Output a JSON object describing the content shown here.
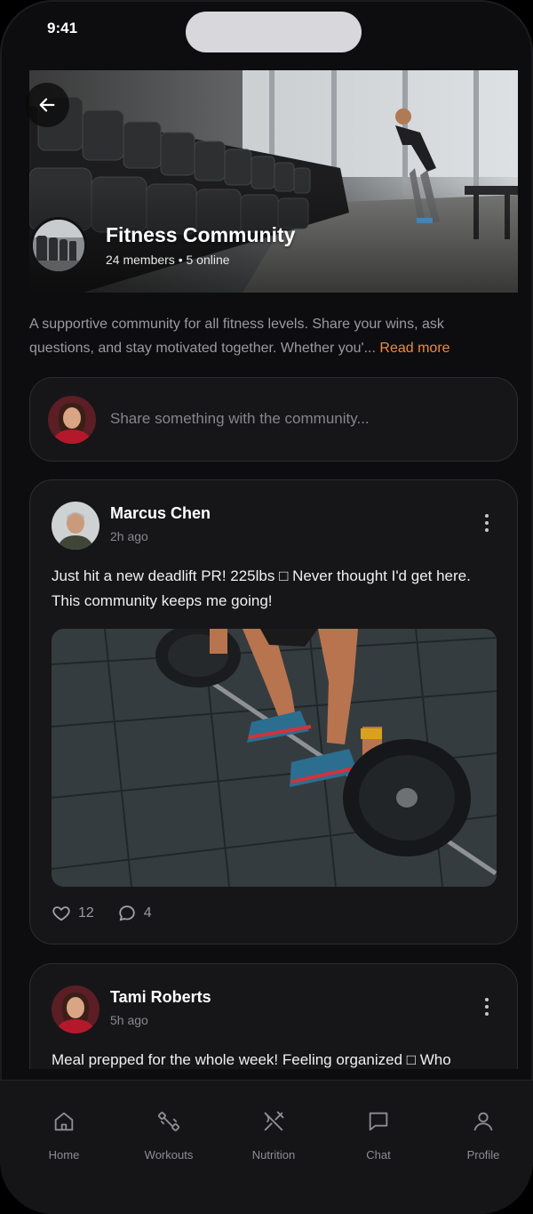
{
  "status_bar": {
    "time": "9:41"
  },
  "group": {
    "name": "Fitness Community",
    "meta": "24 members • 5 online",
    "description": "A supportive community for all fitness levels. Share your wins, ask questions, and stay motivated together. Whether you'...",
    "read_more": "Read more"
  },
  "composer": {
    "placeholder": "Share something with the community..."
  },
  "posts": [
    {
      "author": "Marcus Chen",
      "time": "2h ago",
      "text": "Just hit a new deadlift PR! 225lbs □ Never thought I'd get here. This community keeps me going!",
      "likes": "12",
      "comments": "4"
    },
    {
      "author": "Tami Roberts",
      "time": "5h ago",
      "text": "Meal prepped for the whole week! Feeling organized □ Who"
    }
  ],
  "nav": {
    "items": [
      {
        "label": "Home",
        "icon": "home-icon"
      },
      {
        "label": "Workouts",
        "icon": "dumbbell-icon"
      },
      {
        "label": "Nutrition",
        "icon": "utensils-icon"
      },
      {
        "label": "Chat",
        "icon": "chat-icon"
      },
      {
        "label": "Profile",
        "icon": "user-icon"
      }
    ]
  },
  "colors": {
    "background": "#0d0d0f",
    "card": "#161618",
    "accent": "#f08b3a",
    "muted_text": "#9a9aa0"
  }
}
